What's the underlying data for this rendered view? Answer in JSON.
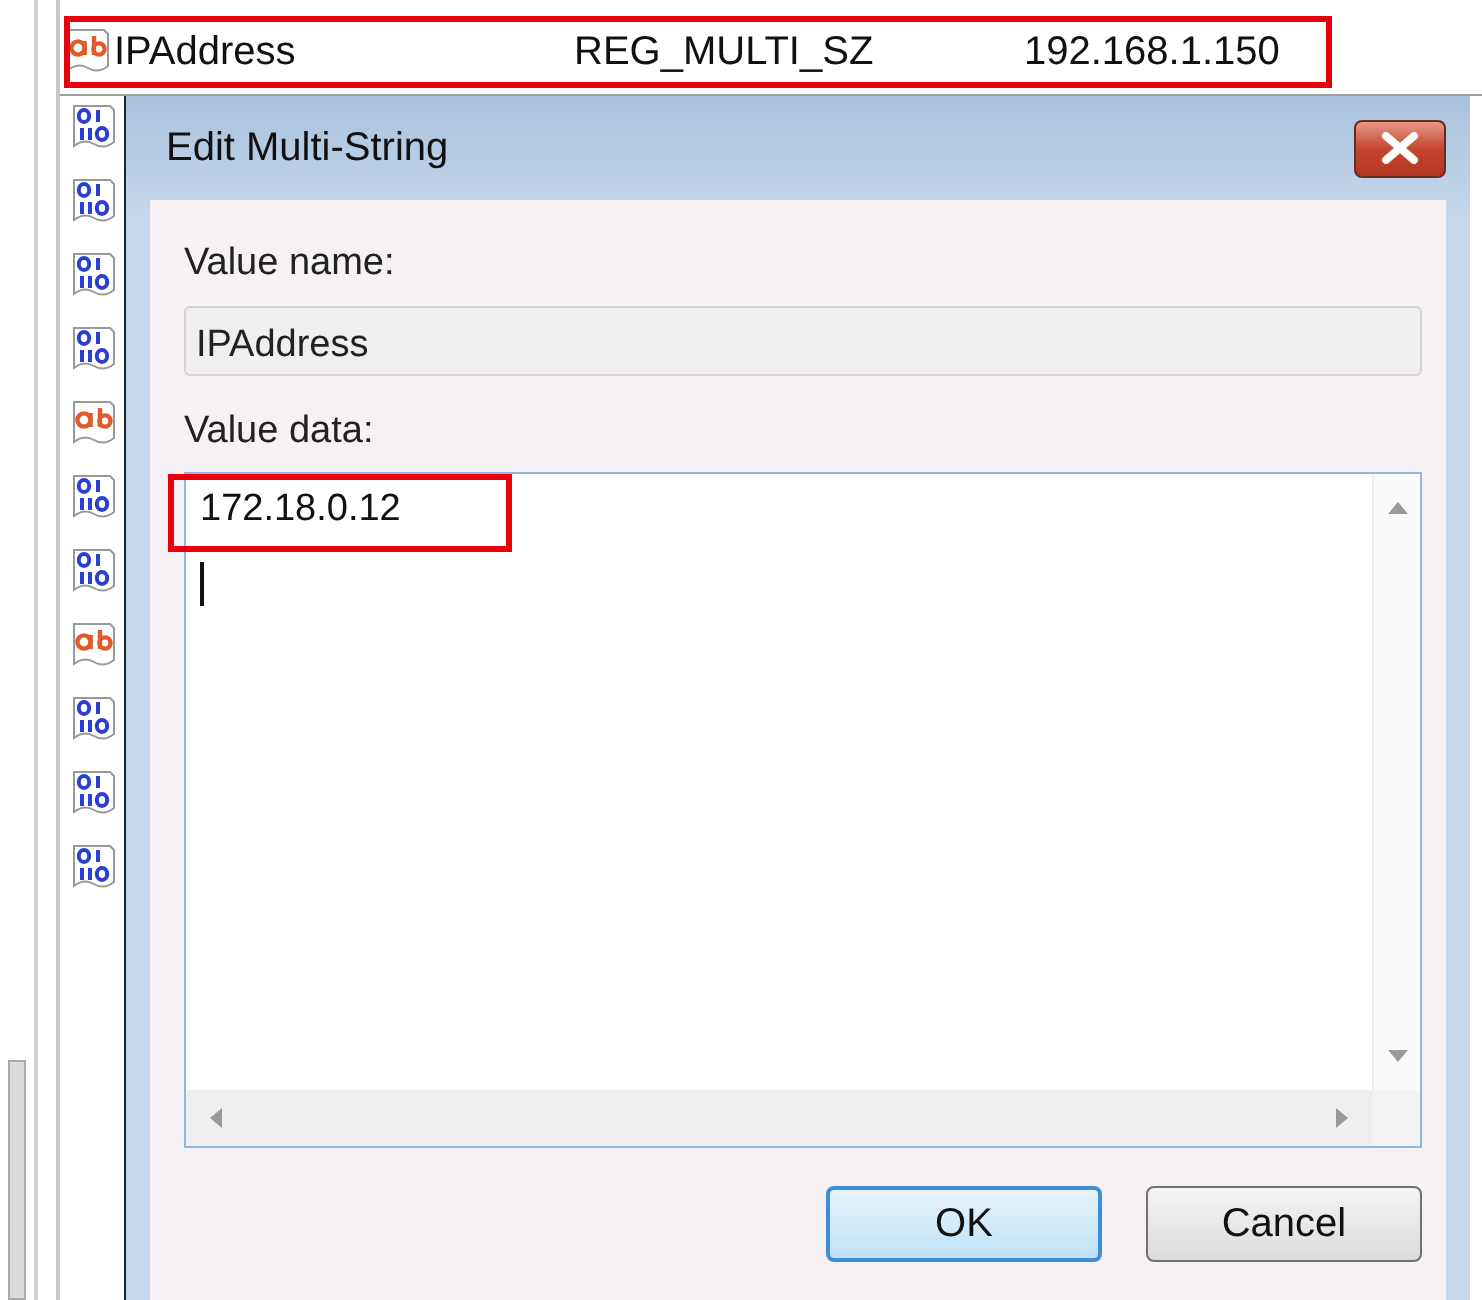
{
  "registry_row": {
    "kind": "string",
    "name": "IPAddress",
    "type": "REG_MULTI_SZ",
    "data": "192.168.1.150",
    "highlighted": true
  },
  "list_icons": [
    {
      "kind": "binary"
    },
    {
      "kind": "binary"
    },
    {
      "kind": "binary"
    },
    {
      "kind": "binary"
    },
    {
      "kind": "string"
    },
    {
      "kind": "binary"
    },
    {
      "kind": "binary"
    },
    {
      "kind": "string"
    },
    {
      "kind": "binary"
    },
    {
      "kind": "binary"
    },
    {
      "kind": "binary"
    }
  ],
  "dialog": {
    "title": "Edit Multi-String",
    "value_name_label": "Value name:",
    "value_name": "IPAddress",
    "value_data_label": "Value data:",
    "value_data_lines": [
      "172.18.0.12"
    ],
    "value_data_highlighted": true,
    "buttons": [
      {
        "label": "OK",
        "default": true
      },
      {
        "label": "Cancel",
        "default": false
      }
    ]
  }
}
